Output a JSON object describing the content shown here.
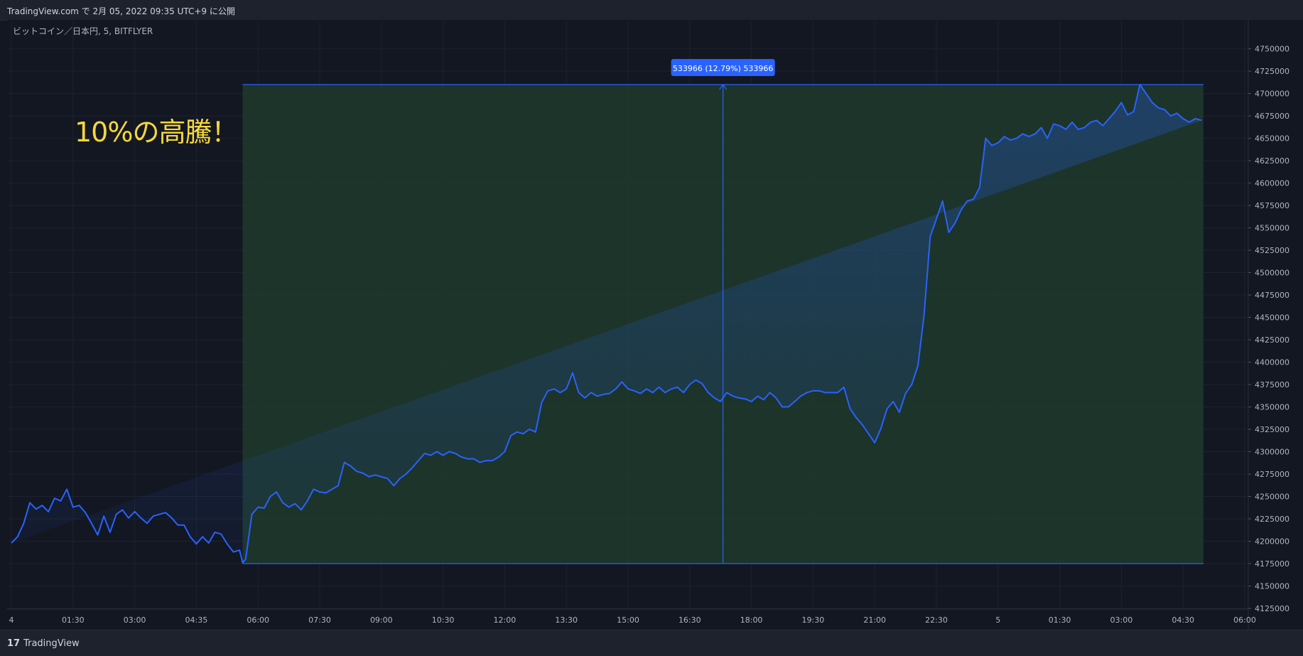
{
  "header": {
    "title": "TradingView.com で 2月 05, 2022 09:35 UTC+9 に公開"
  },
  "symbol": {
    "label": "ビットコイン／日本円, 5, BITFLYER"
  },
  "annotation": {
    "text": "10%の高騰！"
  },
  "range_tooltip": {
    "text": "533966 (12.79%) 533966"
  },
  "brand": {
    "name": "TradingView",
    "logo_glyph": "17"
  },
  "colors": {
    "line": "#2962ff",
    "range_fill": "#1f3a2b",
    "annotation": "#f7d83a",
    "tooltip_bg": "#2962ff"
  },
  "chart_data": {
    "type": "area",
    "ylim": [
      4125000,
      4760000
    ],
    "y_ticks": [
      4125000,
      4150000,
      4175000,
      4200000,
      4225000,
      4250000,
      4275000,
      4300000,
      4325000,
      4350000,
      4375000,
      4400000,
      4425000,
      4450000,
      4475000,
      4500000,
      4525000,
      4550000,
      4575000,
      4600000,
      4625000,
      4650000,
      4675000,
      4700000,
      4725000,
      4750000
    ],
    "x_ticks": [
      "4",
      "01:30",
      "03:00",
      "04:35",
      "06:00",
      "07:30",
      "09:00",
      "10:30",
      "12:00",
      "13:30",
      "15:00",
      "16:30",
      "18:00",
      "19:30",
      "21:00",
      "22:30",
      "5",
      "01:30",
      "03:00",
      "04:30",
      "06:00"
    ],
    "x_tick_positions": [
      0,
      1,
      2,
      3,
      4,
      5,
      6,
      7,
      8,
      9,
      10,
      11,
      12,
      13,
      14,
      15,
      16,
      17,
      18,
      19,
      20
    ],
    "price_range": {
      "x_start": 3.75,
      "x_end": 19.33,
      "low": 4175000,
      "high": 4710000
    },
    "x": [
      0,
      0.1,
      0.2,
      0.3,
      0.4,
      0.5,
      0.6,
      0.7,
      0.8,
      0.9,
      1,
      1.1,
      1.2,
      1.3,
      1.4,
      1.5,
      1.6,
      1.7,
      1.8,
      1.9,
      2,
      2.1,
      2.2,
      2.3,
      2.4,
      2.5,
      2.6,
      2.7,
      2.8,
      2.9,
      3,
      3.1,
      3.2,
      3.3,
      3.4,
      3.5,
      3.6,
      3.7,
      3.75,
      3.8,
      3.9,
      4,
      4.1,
      4.2,
      4.3,
      4.4,
      4.5,
      4.6,
      4.7,
      4.8,
      4.9,
      5,
      5.1,
      5.2,
      5.3,
      5.4,
      5.5,
      5.6,
      5.7,
      5.8,
      5.9,
      6,
      6.1,
      6.2,
      6.3,
      6.4,
      6.5,
      6.6,
      6.7,
      6.8,
      6.9,
      7,
      7.1,
      7.2,
      7.3,
      7.4,
      7.5,
      7.6,
      7.7,
      7.8,
      7.9,
      8,
      8.1,
      8.2,
      8.3,
      8.4,
      8.5,
      8.6,
      8.7,
      8.8,
      8.9,
      9,
      9.1,
      9.2,
      9.3,
      9.4,
      9.5,
      9.6,
      9.7,
      9.8,
      9.9,
      10,
      10.1,
      10.2,
      10.3,
      10.4,
      10.5,
      10.6,
      10.7,
      10.8,
      10.9,
      11,
      11.1,
      11.2,
      11.3,
      11.4,
      11.5,
      11.6,
      11.7,
      11.8,
      11.9,
      12,
      12.1,
      12.2,
      12.3,
      12.4,
      12.5,
      12.6,
      12.7,
      12.8,
      12.9,
      13,
      13.1,
      13.2,
      13.3,
      13.4,
      13.5,
      13.6,
      13.7,
      13.8,
      13.9,
      14,
      14.1,
      14.2,
      14.3,
      14.4,
      14.5,
      14.6,
      14.7,
      14.8,
      14.9,
      15,
      15.1,
      15.2,
      15.3,
      15.4,
      15.5,
      15.6,
      15.7,
      15.8,
      15.9,
      16,
      16.1,
      16.2,
      16.3,
      16.4,
      16.5,
      16.6,
      16.7,
      16.8,
      16.9,
      17,
      17.1,
      17.2,
      17.3,
      17.4,
      17.5,
      17.6,
      17.7,
      17.8,
      17.9,
      18,
      18.1,
      18.2,
      18.3,
      18.4,
      18.5,
      18.6,
      18.7,
      18.8,
      18.9,
      19,
      19.1,
      19.2,
      19.3,
      19.4,
      19.5,
      19.6,
      19.7,
      19.8,
      19.9,
      20,
      20.2
    ],
    "y": [
      4198000,
      4205000,
      4220000,
      4243000,
      4236000,
      4240000,
      4233000,
      4248000,
      4245000,
      4258000,
      4238000,
      4240000,
      4232000,
      4220000,
      4207000,
      4228000,
      4210000,
      4230000,
      4235000,
      4226000,
      4233000,
      4226000,
      4220000,
      4228000,
      4230000,
      4232000,
      4226000,
      4218000,
      4218000,
      4205000,
      4197000,
      4205000,
      4198000,
      4210000,
      4208000,
      4197000,
      4188000,
      4190000,
      4176000,
      4180000,
      4230000,
      4238000,
      4237000,
      4250000,
      4255000,
      4243000,
      4238000,
      4242000,
      4235000,
      4245000,
      4258000,
      4255000,
      4254000,
      4258000,
      4262000,
      4288000,
      4284000,
      4278000,
      4276000,
      4272000,
      4274000,
      4272000,
      4270000,
      4262000,
      4270000,
      4275000,
      4282000,
      4290000,
      4298000,
      4296000,
      4300000,
      4296000,
      4300000,
      4298000,
      4294000,
      4292000,
      4292000,
      4288000,
      4290000,
      4290000,
      4294000,
      4300000,
      4318000,
      4322000,
      4320000,
      4325000,
      4322000,
      4355000,
      4368000,
      4370000,
      4366000,
      4370000,
      4388000,
      4366000,
      4360000,
      4366000,
      4362000,
      4364000,
      4365000,
      4370000,
      4378000,
      4370000,
      4368000,
      4365000,
      4370000,
      4366000,
      4372000,
      4366000,
      4370000,
      4372000,
      4366000,
      4375000,
      4380000,
      4376000,
      4366000,
      4360000,
      4356000,
      4366000,
      4362000,
      4360000,
      4359000,
      4356000,
      4362000,
      4358000,
      4366000,
      4360000,
      4350000,
      4350000,
      4356000,
      4362000,
      4366000,
      4368000,
      4368000,
      4366000,
      4366000,
      4366000,
      4372000,
      4348000,
      4338000,
      4330000,
      4320000,
      4310000,
      4326000,
      4348000,
      4356000,
      4344000,
      4365000,
      4375000,
      4396000,
      4452000,
      4540000,
      4560000,
      4580000,
      4545000,
      4555000,
      4570000,
      4580000,
      4582000,
      4595000,
      4650000,
      4642000,
      4645000,
      4652000,
      4648000,
      4650000,
      4655000,
      4652000,
      4655000,
      4662000,
      4650000,
      4666000,
      4664000,
      4660000,
      4668000,
      4660000,
      4662000,
      4668000,
      4670000,
      4664000,
      4672000,
      4680000,
      4690000,
      4676000,
      4680000,
      4710000,
      4700000,
      4690000,
      4684000,
      4682000,
      4675000,
      4678000,
      4672000,
      4668000,
      4672000,
      4670000
    ]
  }
}
